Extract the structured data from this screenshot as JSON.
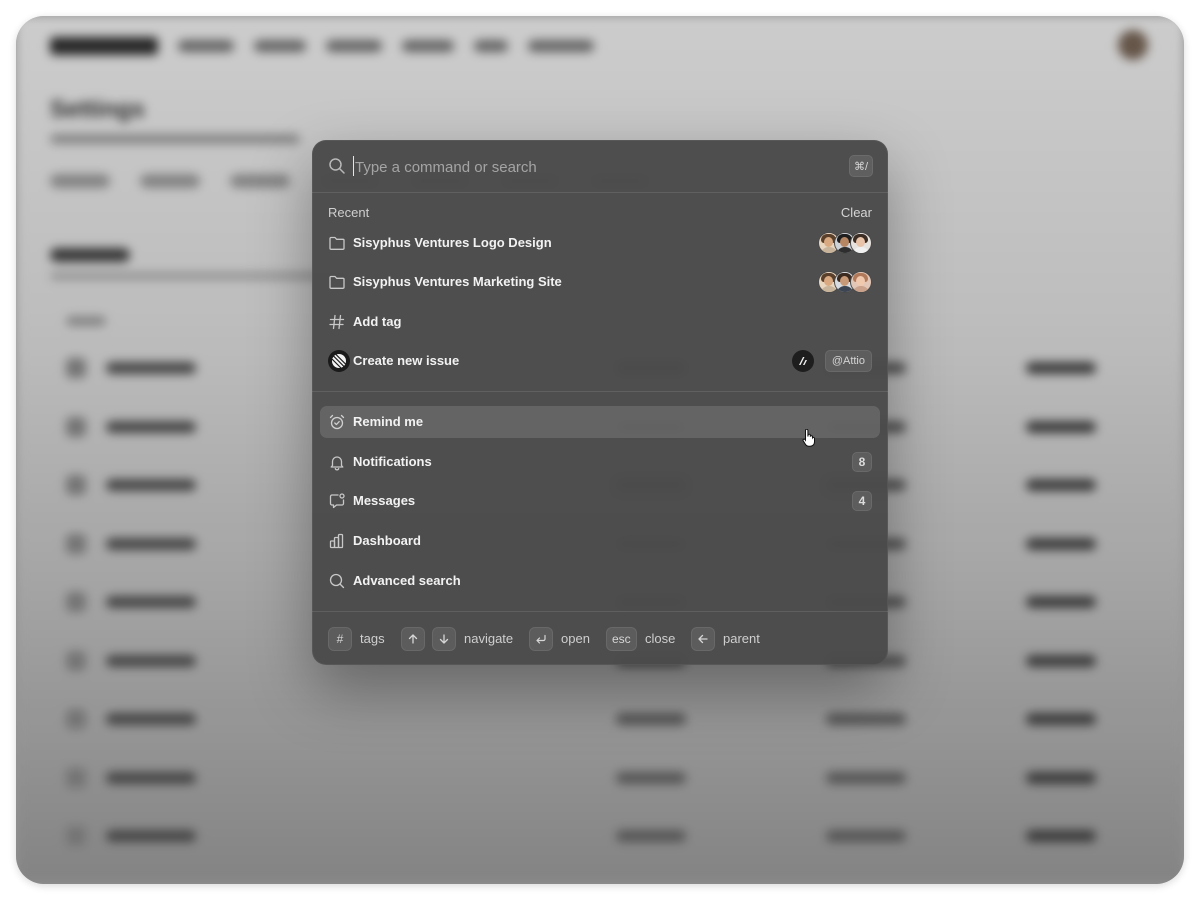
{
  "background": {
    "page_title": "Settings"
  },
  "search": {
    "placeholder": "Type a command or search",
    "shortcut": "⌘/"
  },
  "recent": {
    "label": "Recent",
    "clear_label": "Clear",
    "items": [
      {
        "label": "Sisyphus Ventures Logo Design",
        "icon": "folder-icon"
      },
      {
        "label": "Sisyphus Ventures Marketing Site",
        "icon": "folder-icon"
      },
      {
        "label": "Add tag",
        "icon": "hash-icon"
      },
      {
        "label": "Create new issue",
        "icon": "linear-logo-icon",
        "tag": "@Attio"
      }
    ]
  },
  "actions": {
    "items": [
      {
        "label": "Remind me",
        "icon": "alarm-clock-icon",
        "active": true
      },
      {
        "label": "Notifications",
        "icon": "bell-icon",
        "count": "8"
      },
      {
        "label": "Messages",
        "icon": "message-icon",
        "count": "4"
      },
      {
        "label": "Dashboard",
        "icon": "bar-chart-icon"
      },
      {
        "label": "Advanced search",
        "icon": "search-icon"
      }
    ]
  },
  "footer": {
    "tags_key": "#",
    "tags_label": "tags",
    "navigate_label": "navigate",
    "open_label": "open",
    "esc_key": "esc",
    "close_label": "close",
    "parent_label": "parent"
  },
  "colors": {
    "palette_bg": "#4a4a4a",
    "active_row": "#5f5f5f",
    "text": "#f2f2f2",
    "muted_text": "#cfcfcf"
  }
}
